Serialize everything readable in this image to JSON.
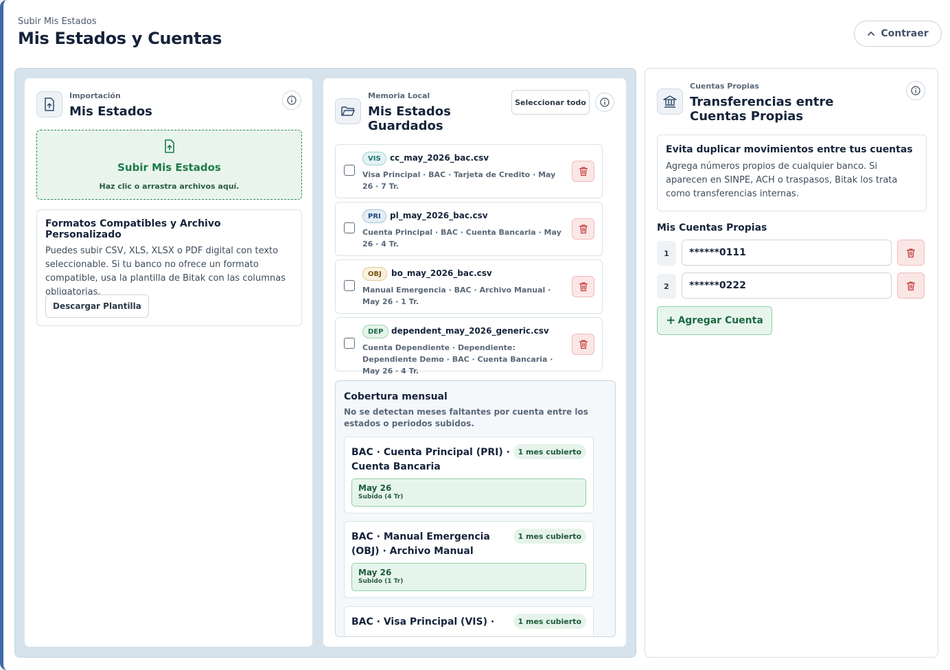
{
  "header": {
    "subtitle": "Subir Mis Estados",
    "title": "Mis Estados y Cuentas",
    "collapse_label": "Contraer"
  },
  "import_panel": {
    "eyebrow": "Importación",
    "title": "Mis Estados",
    "dropzone_title": "Subir Mis Estados",
    "dropzone_hint": "Haz clic o arrastra archivos aquí.",
    "formats_title": "Formatos Compatibles y Archivo Personalizado",
    "formats_text": "Puedes subir CSV, XLS, XLSX o PDF digital con texto seleccionable. Si tu banco no ofrece un formato compatible, usa la plantilla de Bitak con las columnas obligatorias.",
    "template_button": "Descargar Plantilla"
  },
  "saved_panel": {
    "eyebrow": "Memoria Local",
    "title": "Mis Estados Guardados",
    "select_all": "Seleccionar todo",
    "files": [
      {
        "tag": "VIS",
        "name": "cc_may_2026_bac.csv",
        "meta": "Visa Principal · BAC · Tarjeta de Credito · May 26 · 7 Tr."
      },
      {
        "tag": "PRI",
        "name": "pl_may_2026_bac.csv",
        "meta": "Cuenta Principal · BAC · Cuenta Bancaria · May 26 · 4 Tr."
      },
      {
        "tag": "OBJ",
        "name": "bo_may_2026_bac.csv",
        "meta": "Manual Emergencia · BAC · Archivo Manual · May 26 · 1 Tr."
      },
      {
        "tag": "DEP",
        "name": "dependent_may_2026_generic.csv",
        "meta": "Cuenta Dependiente · Dependiente: Dependiente Demo · BAC · Cuenta Bancaria · May 26 · 4 Tr."
      }
    ],
    "coverage": {
      "title": "Cobertura mensual",
      "description": "No se detectan meses faltantes por cuenta entre los estados o periodos subidos.",
      "cards": [
        {
          "title": "BAC · Cuenta Principal (PRI) · Cuenta Bancaria",
          "badge": "1 mes cubierto",
          "month": "May 26",
          "status": "Subido (4 Tr)"
        },
        {
          "title": "BAC · Manual Emergencia (OBJ) · Archivo Manual",
          "badge": "1 mes cubierto",
          "month": "May 26",
          "status": "Subido (1 Tr)"
        },
        {
          "title": "BAC · Visa Principal (VIS) ·",
          "badge": "1 mes cubierto",
          "month": "",
          "status": ""
        }
      ]
    }
  },
  "transfers_panel": {
    "eyebrow": "Cuentas Propias",
    "title": "Transferencias entre Cuentas Propias",
    "notice_title": "Evita duplicar movimientos entre tus cuentas",
    "notice_text": "Agrega números propios de cualquier banco. Si aparecen en SINPE, ACH o traspasos, Bitak los trata como transferencias internas.",
    "own_accounts_label": "Mis Cuentas Propias",
    "accounts": [
      {
        "index": "1",
        "value": "******0111"
      },
      {
        "index": "2",
        "value": "******0222"
      }
    ],
    "add_button": "Agregar Cuenta"
  }
}
